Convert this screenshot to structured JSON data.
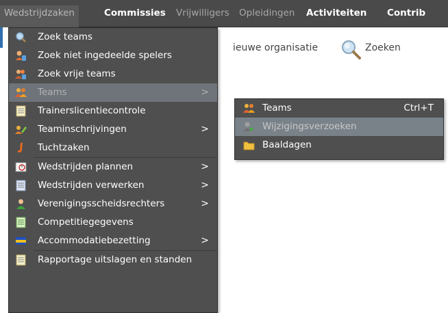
{
  "menubar": {
    "items": [
      {
        "label": "Wedstrijdzaken",
        "state": "active"
      },
      {
        "label": "Commissies",
        "state": "bold"
      },
      {
        "label": "Vrijwilligers",
        "state": "dim"
      },
      {
        "label": "Opleidingen",
        "state": "dim"
      },
      {
        "label": "Activiteiten",
        "state": "bold"
      },
      {
        "label": "Contrib",
        "state": "bold"
      }
    ]
  },
  "toolbar": {
    "new_org_label": "ieuwe organisatie",
    "search_label": "Zoeken"
  },
  "menu_wedstrijdzaken": {
    "items": [
      {
        "label": "Zoek teams",
        "icon": "magnifier-icon",
        "submenu": false
      },
      {
        "label": "Zoek niet ingedeelde spelers",
        "icon": "user-question-icon",
        "submenu": false
      },
      {
        "label": "Zoek vrije teams",
        "icon": "group-question-icon",
        "submenu": false
      },
      {
        "label": "Teams",
        "icon": "team-icon",
        "submenu": true,
        "highlighted": true
      },
      {
        "label": "Trainerslicentiecontrole",
        "icon": "document-icon",
        "submenu": false
      },
      {
        "label": "Teaminschrijvingen",
        "icon": "team-edit-icon",
        "submenu": true
      },
      {
        "label": "Tuchtzaken",
        "icon": "discipline-icon",
        "submenu": false
      },
      {
        "label": "Wedstrijden plannen",
        "icon": "planning-icon",
        "submenu": true
      },
      {
        "label": "Wedstrijden verwerken",
        "icon": "document-icon",
        "submenu": true
      },
      {
        "label": "Verenigingsscheidsrechters",
        "icon": "referee-icon",
        "submenu": true
      },
      {
        "label": "Competitiegegevens",
        "icon": "document-green-icon",
        "submenu": false
      },
      {
        "label": "Accommodatiebezetting",
        "icon": "field-icon",
        "submenu": true
      },
      {
        "label": "Rapportage uitslagen en standen",
        "icon": "report-icon",
        "submenu": false
      }
    ],
    "arrow": ">"
  },
  "menu_teams": {
    "items": [
      {
        "label": "Teams",
        "icon": "team-icon",
        "shortcut": "Ctrl+T"
      },
      {
        "label": "Wijzigingsverzoeken",
        "icon": "user-change-icon",
        "shortcut": "",
        "highlighted": true
      },
      {
        "label": "Baaldagen",
        "icon": "folder-icon",
        "shortcut": ""
      }
    ]
  },
  "colors": {
    "menu_bg": "#4f4f4f",
    "menubar_bg": "#4a4a4a",
    "highlight_bg": "#6e7479",
    "text": "#ffffff"
  }
}
